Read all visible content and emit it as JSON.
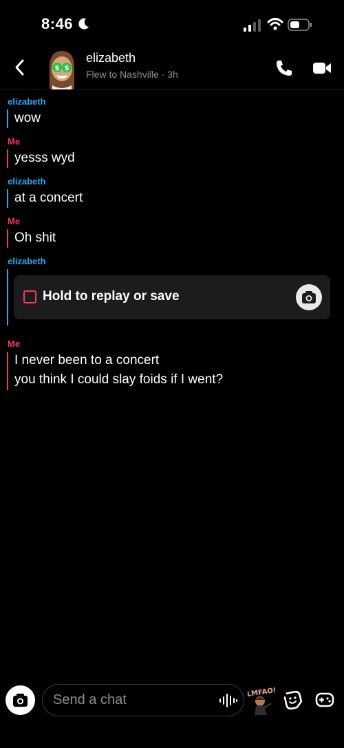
{
  "status_bar": {
    "time": "8:46"
  },
  "header": {
    "contact_name": "elizabeth",
    "contact_status": "Flew to Nashville · 3h"
  },
  "messages": [
    {
      "sender": "elizabeth",
      "text": "wow"
    },
    {
      "sender": "Me",
      "text": "yesss wyd"
    },
    {
      "sender": "elizabeth",
      "text": "at a concert"
    },
    {
      "sender": "Me",
      "text": "Oh shit"
    },
    {
      "sender": "elizabeth",
      "snap_label": "Hold to replay or save"
    },
    {
      "sender": "Me",
      "lines": [
        "I never been to a concert",
        "you think I could slay foids if I went?"
      ]
    }
  ],
  "composer": {
    "placeholder": "Send a chat",
    "bitmoji_text": "LMFAO!"
  },
  "colors": {
    "other_accent": "#2ea6f0",
    "me_accent": "#f23c57",
    "background": "#000000"
  }
}
